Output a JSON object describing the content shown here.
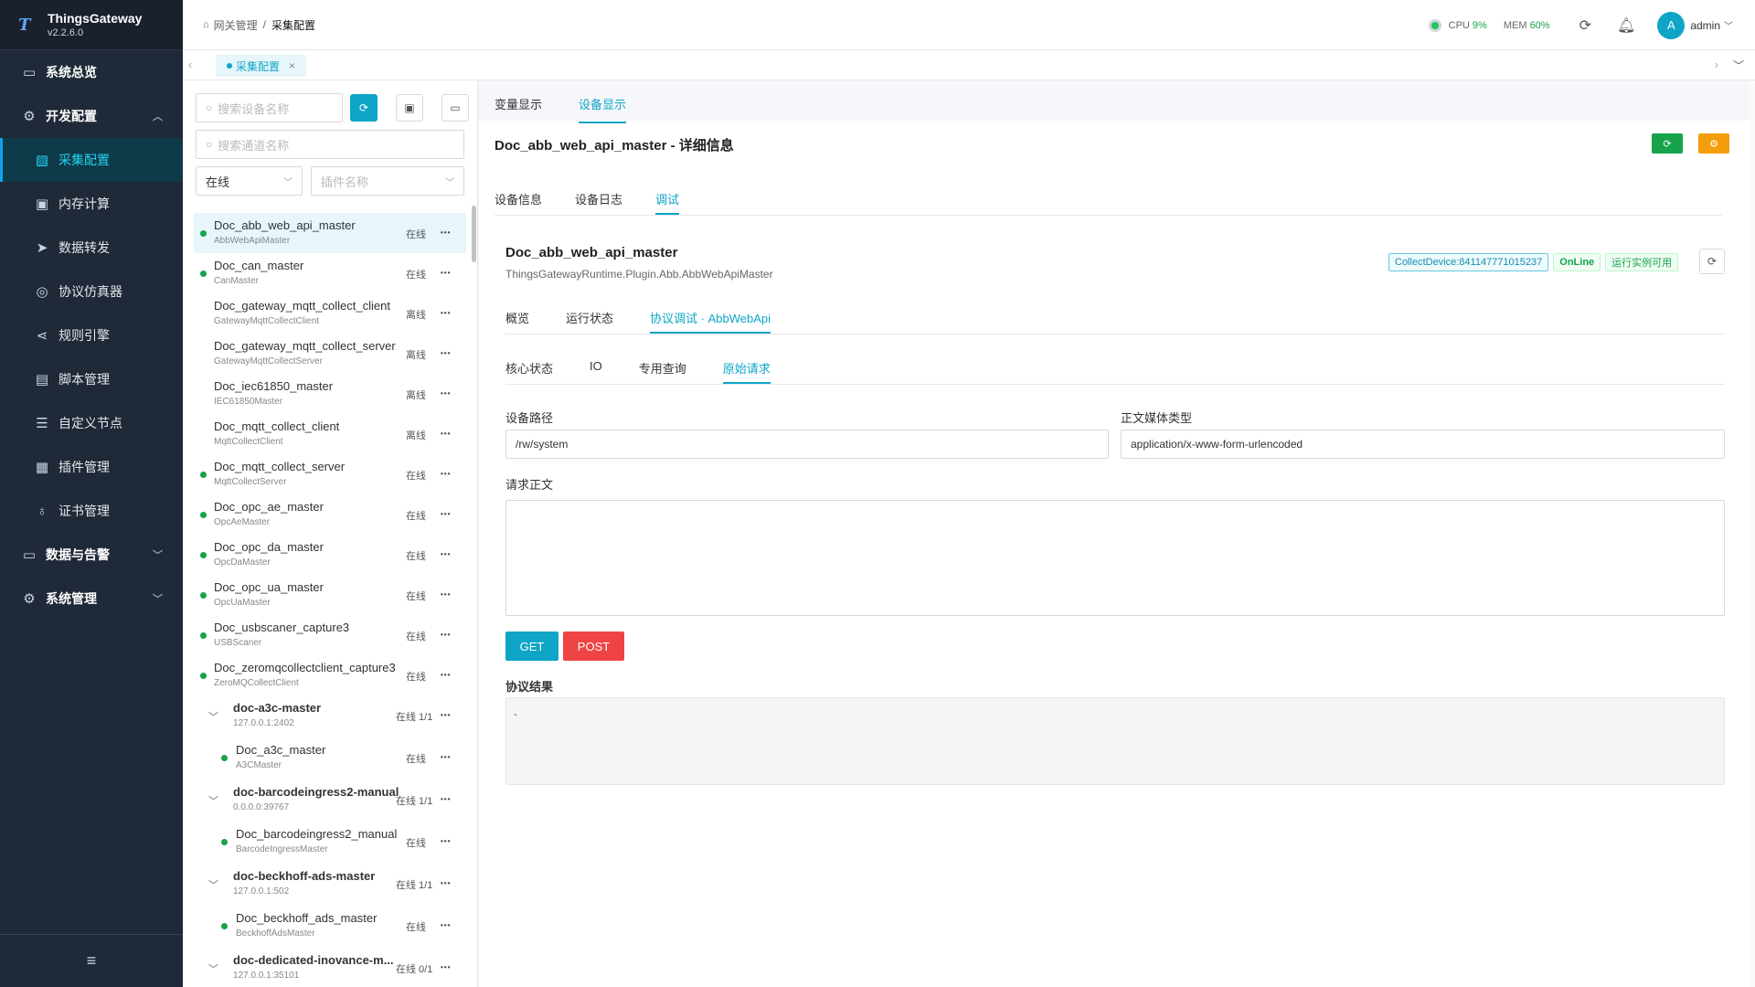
{
  "brand": {
    "name": "ThingsGateway",
    "version": "v2.2.6.0",
    "logo": "T"
  },
  "sidebar": {
    "items": [
      {
        "label": "系统总览",
        "icon": "monitor-icon",
        "glyph": "▭",
        "kind": "group"
      },
      {
        "label": "开发配置",
        "icon": "gear-icon",
        "glyph": "⚙",
        "kind": "group",
        "chev": "︿"
      },
      {
        "label": "采集配置",
        "icon": "chart-monitor-icon",
        "glyph": "▧",
        "kind": "sub-active"
      },
      {
        "label": "内存计算",
        "icon": "chip-icon",
        "glyph": "▣",
        "kind": "sub"
      },
      {
        "label": "数据转发",
        "icon": "send-icon",
        "glyph": "➤",
        "kind": "sub"
      },
      {
        "label": "协议仿真器",
        "icon": "simulator-icon",
        "glyph": "◎",
        "kind": "sub"
      },
      {
        "label": "规则引擎",
        "icon": "share-icon",
        "glyph": "⋖",
        "kind": "sub"
      },
      {
        "label": "脚本管理",
        "icon": "document-icon",
        "glyph": "▤",
        "kind": "sub"
      },
      {
        "label": "自定义节点",
        "icon": "sliders-icon",
        "glyph": "☰",
        "kind": "sub"
      },
      {
        "label": "插件管理",
        "icon": "plugin-icon",
        "glyph": "▦",
        "kind": "sub"
      },
      {
        "label": "证书管理",
        "icon": "certificate-icon",
        "glyph": "♁",
        "kind": "sub"
      },
      {
        "label": "数据与告警",
        "icon": "monitor-alert-icon",
        "glyph": "▭",
        "kind": "group",
        "chev": "﹀"
      },
      {
        "label": "系统管理",
        "icon": "settings-icon",
        "glyph": "⚙",
        "kind": "group",
        "chev": "﹀"
      }
    ],
    "collapse_glyph": "≡"
  },
  "header": {
    "breadcrumb": [
      "网关管理",
      "采集配置"
    ],
    "cpu_label": "CPU",
    "cpu_value": "9%",
    "mem_label": "MEM",
    "mem_value": "60%",
    "user_initial": "A",
    "username": "admin"
  },
  "tabbar": {
    "tab_label": "采集配置",
    "close": "×"
  },
  "devpanel": {
    "search_device_placeholder": "搜索设备名称",
    "search_channel_placeholder": "搜索通道名称",
    "status_select": "在线",
    "plugin_select_placeholder": "插件名称",
    "devices": [
      {
        "name": "Doc_abb_web_api_master",
        "sub": "AbbWebApiMaster",
        "status": "在线",
        "online": true,
        "type": "dev",
        "selected": true
      },
      {
        "name": "Doc_can_master",
        "sub": "CanMaster",
        "status": "在线",
        "online": true,
        "type": "dev"
      },
      {
        "name": "Doc_gateway_mqtt_collect_client",
        "sub": "GatewayMqttCollectClient",
        "status": "离线",
        "online": false,
        "type": "dev"
      },
      {
        "name": "Doc_gateway_mqtt_collect_server",
        "sub": "GatewayMqttCollectServer",
        "status": "离线",
        "online": false,
        "type": "dev"
      },
      {
        "name": "Doc_iec61850_master",
        "sub": "IEC61850Master",
        "status": "离线",
        "online": false,
        "type": "dev"
      },
      {
        "name": "Doc_mqtt_collect_client",
        "sub": "MqttCollectClient",
        "status": "离线",
        "online": false,
        "type": "dev"
      },
      {
        "name": "Doc_mqtt_collect_server",
        "sub": "MqttCollectServer",
        "status": "在线",
        "online": true,
        "type": "dev"
      },
      {
        "name": "Doc_opc_ae_master",
        "sub": "OpcAeMaster",
        "status": "在线",
        "online": true,
        "type": "dev"
      },
      {
        "name": "Doc_opc_da_master",
        "sub": "OpcDaMaster",
        "status": "在线",
        "online": true,
        "type": "dev"
      },
      {
        "name": "Doc_opc_ua_master",
        "sub": "OpcUaMaster",
        "status": "在线",
        "online": true,
        "type": "dev"
      },
      {
        "name": "Doc_usbscaner_capture3",
        "sub": "USBScaner",
        "status": "在线",
        "online": true,
        "type": "dev"
      },
      {
        "name": "Doc_zeromqcollectclient_capture3",
        "sub": "ZeroMQCollectClient",
        "status": "在线",
        "online": true,
        "type": "dev"
      },
      {
        "name": "doc-a3c-master",
        "sub": "127.0.0.1:2402",
        "status": "在线 1/1",
        "type": "grp"
      },
      {
        "name": "Doc_a3c_master",
        "sub": "A3CMaster",
        "status": "在线",
        "online": true,
        "type": "child"
      },
      {
        "name": "doc-barcodeingress2-manual",
        "sub": "0.0.0.0:39767",
        "status": "在线 1/1",
        "type": "grp"
      },
      {
        "name": "Doc_barcodeingress2_manual",
        "sub": "BarcodeIngressMaster",
        "status": "在线",
        "online": true,
        "type": "child"
      },
      {
        "name": "doc-beckhoff-ads-master",
        "sub": "127.0.0.1:502",
        "status": "在线 1/1",
        "type": "grp"
      },
      {
        "name": "Doc_beckhoff_ads_master",
        "sub": "BeckhoffAdsMaster",
        "status": "在线",
        "online": true,
        "type": "child"
      },
      {
        "name": "doc-dedicated-inovance-m...",
        "sub": "127.0.0.1:35101",
        "status": "在线 0/1",
        "type": "grp"
      }
    ]
  },
  "main": {
    "top_tabs": [
      {
        "label": "变量显示",
        "active": false
      },
      {
        "label": "设备显示",
        "active": true
      }
    ],
    "detail_title": "Doc_abb_web_api_master - 详细信息",
    "detail_tabs": [
      {
        "label": "设备信息",
        "active": false
      },
      {
        "label": "设备日志",
        "active": false
      },
      {
        "label": "调试",
        "active": true
      }
    ],
    "device_name": "Doc_abb_web_api_master",
    "device_plugin": "ThingsGatewayRuntime.Plugin.Abb.AbbWebApiMaster",
    "badge_collect": "CollectDevice:841147771015237",
    "badge_online": "OnLine",
    "badge_runtime": "运行实例可用",
    "proto_tabs": [
      {
        "label": "概览",
        "active": false
      },
      {
        "label": "运行状态",
        "active": false
      },
      {
        "label": "协议调试 · AbbWebApi",
        "active": true
      }
    ],
    "debug_tabs": [
      {
        "label": "核心状态",
        "active": false
      },
      {
        "label": "IO",
        "active": false
      },
      {
        "label": "专用查询",
        "active": false
      },
      {
        "label": "原始请求",
        "active": true
      }
    ],
    "device_path_label": "设备路径",
    "device_path_value": "/rw/system",
    "media_type_label": "正文媒体类型",
    "media_type_value": "application/x-www-form-urlencoded",
    "body_label": "请求正文",
    "get_label": "GET",
    "post_label": "POST",
    "result_label": "协议结果",
    "result_value": "-"
  }
}
